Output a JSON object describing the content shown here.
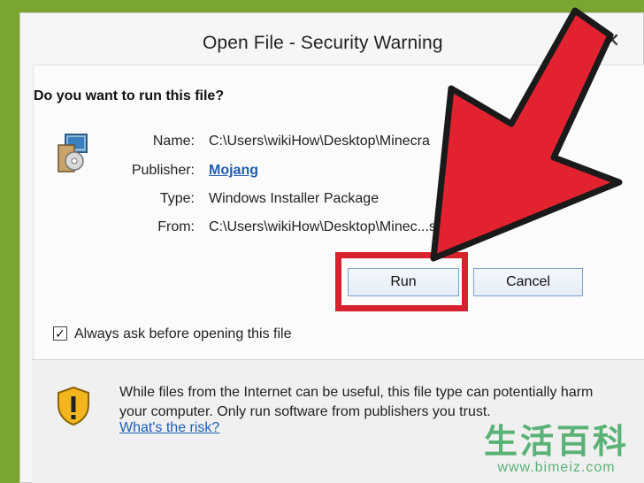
{
  "dialog": {
    "title": "Open File - Security Warning",
    "question": "Do you want to run this file?",
    "fields": [
      {
        "label": "Name:",
        "value": "C:\\Users\\wikiHow\\Desktop\\Minecra"
      },
      {
        "label": "Publisher:",
        "value": "Mojang"
      },
      {
        "label": "Type:",
        "value": "Windows Installer Package"
      },
      {
        "label": "From:",
        "value": "C:\\Users\\wikiHow\\Desktop\\Minec...staller.msi"
      }
    ],
    "buttons": {
      "run": "Run",
      "cancel": "Cancel"
    },
    "checkbox": {
      "label": "Always ask before opening this file",
      "checked": true
    },
    "warning": {
      "text": "While files from the Internet can be useful, this file type can potentially harm your computer. Only run software from publishers you trust.",
      "link": "What's the risk?"
    },
    "close_symbol": "✕"
  },
  "annotation": {
    "arrow_color": "#d7212f",
    "highlight_color": "#d7212f"
  },
  "watermark": {
    "chars": "生活百科",
    "url": "www.bimeiz.com"
  }
}
